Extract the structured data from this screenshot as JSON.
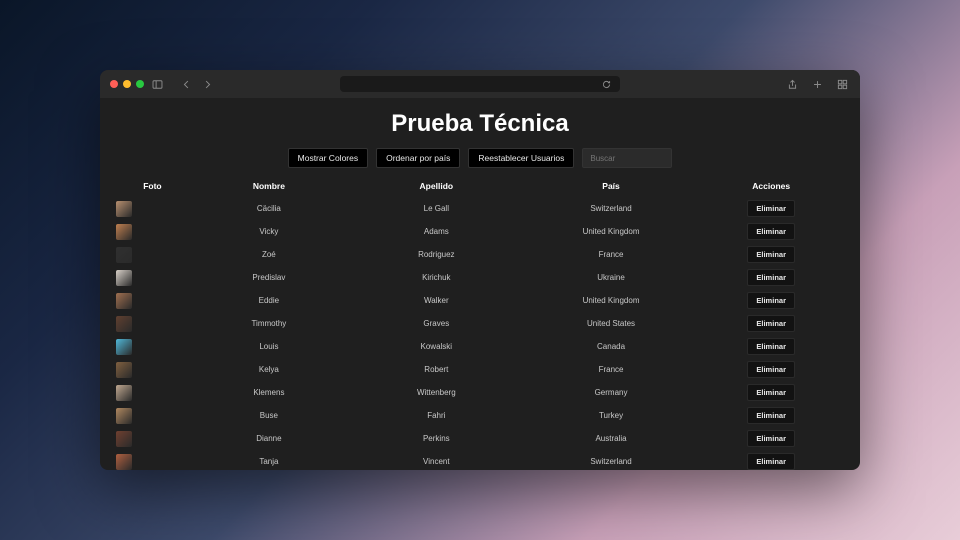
{
  "page": {
    "title": "Prueba Técnica"
  },
  "toolbar": {
    "show_colors": "Mostrar Colores",
    "sort_country": "Ordenar por país",
    "reset_users": "Reestablecer Usuarios",
    "search_placeholder": "Buscar"
  },
  "table": {
    "headers": {
      "photo": "Foto",
      "name": "Nombre",
      "surname": "Apellido",
      "country": "País",
      "actions": "Acciones"
    },
    "delete_label": "Eliminar",
    "rows": [
      {
        "name": "Cäcilia",
        "surname": "Le Gall",
        "country": "Switzerland",
        "avatar_color": "#b89070"
      },
      {
        "name": "Vicky",
        "surname": "Adams",
        "country": "United Kingdom",
        "avatar_color": "#c08050"
      },
      {
        "name": "Zoé",
        "surname": "Rodriguez",
        "country": "France",
        "avatar_color": "#303030"
      },
      {
        "name": "Predislav",
        "surname": "Kirichuk",
        "country": "Ukraine",
        "avatar_color": "#d8d0c8"
      },
      {
        "name": "Eddie",
        "surname": "Walker",
        "country": "United Kingdom",
        "avatar_color": "#a07050"
      },
      {
        "name": "Timmothy",
        "surname": "Graves",
        "country": "United States",
        "avatar_color": "#604030"
      },
      {
        "name": "Louis",
        "surname": "Kowalski",
        "country": "Canada",
        "avatar_color": "#50b8d8"
      },
      {
        "name": "Kelya",
        "surname": "Robert",
        "country": "France",
        "avatar_color": "#806040"
      },
      {
        "name": "Klemens",
        "surname": "Wittenberg",
        "country": "Germany",
        "avatar_color": "#c0a890"
      },
      {
        "name": "Buse",
        "surname": "Fahri",
        "country": "Turkey",
        "avatar_color": "#b08860"
      },
      {
        "name": "Dianne",
        "surname": "Perkins",
        "country": "Australia",
        "avatar_color": "#704030"
      },
      {
        "name": "Tanja",
        "surname": "Vincent",
        "country": "Switzerland",
        "avatar_color": "#b06040"
      }
    ]
  }
}
